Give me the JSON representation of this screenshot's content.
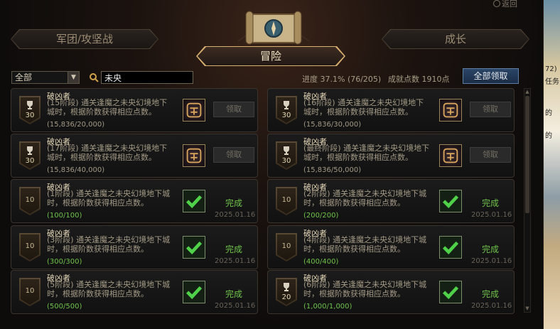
{
  "header": {
    "back_label": "返回",
    "tabs": [
      {
        "label": "军团/攻坚战",
        "active": false
      },
      {
        "label": "冒险",
        "active": true
      },
      {
        "label": "成长",
        "active": false
      }
    ]
  },
  "filter": {
    "selected": "全部",
    "search_value": "未央"
  },
  "summary": {
    "progress_label": "进度",
    "progress_value": "37.1% (76/205)",
    "points_label": "成就点数",
    "points_value": "1910点",
    "claim_all_label": "全部领取"
  },
  "side_strip_texts": [
    "72)",
    "任务",
    "的",
    "的"
  ],
  "achievements": [
    {
      "title": "破凶者",
      "desc": "(15阶段) 通关逢魔之未央幻境地下城时，根据阶数获得相应点数。",
      "progress": "(15,836/20,000)",
      "points": "30",
      "trophy": true,
      "done": false,
      "claim_label": "领取"
    },
    {
      "title": "破凶者",
      "desc": "(16阶段) 通关逢魔之未央幻境地下城时，根据阶数获得相应点数。",
      "progress": "(15,836/30,000)",
      "points": "30",
      "trophy": true,
      "done": false,
      "claim_label": "领取"
    },
    {
      "title": "破凶者",
      "desc": "(17阶段) 通关逢魔之未央幻境地下城时，根据阶数获得相应点数。",
      "progress": "(15,836/40,000)",
      "points": "30",
      "trophy": true,
      "done": false,
      "claim_label": "领取"
    },
    {
      "title": "破凶者",
      "desc": "(最终阶段) 通关逢魔之未央幻境地下城时，根据阶数获得相应点数。",
      "progress": "(15,836/50,000)",
      "points": "30",
      "trophy": true,
      "done": false,
      "claim_label": "领取"
    },
    {
      "title": "破凶者",
      "desc": "(1阶段) 通关逢魔之未央幻境地下城时，根据阶数获得相应点数。",
      "progress": "(100/100)",
      "points": "10",
      "trophy": false,
      "done": true,
      "done_label": "完成",
      "date": "2025.01.16"
    },
    {
      "title": "破凶者",
      "desc": "(2阶段) 通关逢魔之未央幻境地下城时，根据阶数获得相应点数。",
      "progress": "(200/200)",
      "points": "10",
      "trophy": false,
      "done": true,
      "done_label": "完成",
      "date": "2025.01.16"
    },
    {
      "title": "破凶者",
      "desc": "(3阶段) 通关逢魔之未央幻境地下城时，根据阶数获得相应点数。",
      "progress": "(300/300)",
      "points": "10",
      "trophy": false,
      "done": true,
      "done_label": "完成",
      "date": "2025.01.16"
    },
    {
      "title": "破凶者",
      "desc": "(4阶段) 通关逢魔之未央幻境地下城时，根据阶数获得相应点数。",
      "progress": "(400/400)",
      "points": "10",
      "trophy": false,
      "done": true,
      "done_label": "完成",
      "date": "2025.01.16"
    },
    {
      "title": "破凶者",
      "desc": "(5阶段) 通关逢魔之未央幻境地下城时，根据阶数获得相应点数。",
      "progress": "(500/500)",
      "points": "10",
      "trophy": false,
      "done": true,
      "done_label": "完成",
      "date": "2025.01.16"
    },
    {
      "title": "破凶者",
      "desc": "(6阶段) 通关逢魔之未央幻境地下城时，根据阶数获得相应点数。",
      "progress": "(1,000/1,000)",
      "points": "20",
      "trophy": true,
      "done": true,
      "done_label": "完成",
      "date": "2025.01.16"
    }
  ],
  "colors": {
    "done_green": "#6fc34a",
    "accent_gold": "#d8b070",
    "claim_all_blue": "#2b4668"
  }
}
